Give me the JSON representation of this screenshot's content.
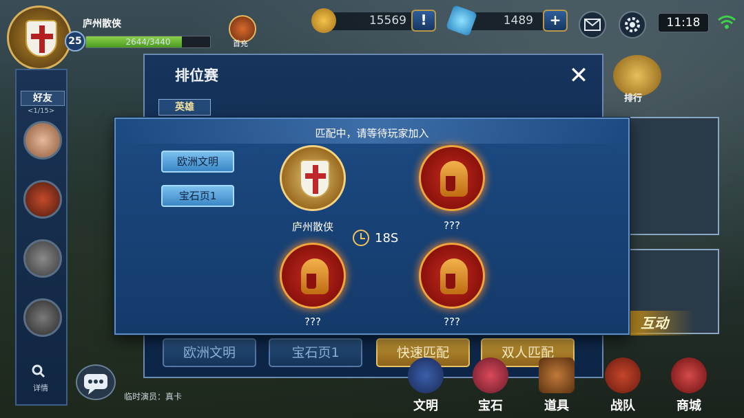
{
  "player": {
    "name": "庐州散侠",
    "level": "25",
    "xp_text": "2644/3440",
    "xp_fraction": 0.77
  },
  "top_bar": {
    "recharge_label": "首充",
    "gold": "15569",
    "gems": "1489",
    "gold_add": "!",
    "gem_add": "+",
    "time": "11:18"
  },
  "sidebar": {
    "friends_label": "好友",
    "friends_count": "<1/15>",
    "detail_label": "详情"
  },
  "rank_panel": {
    "title": "排位赛",
    "close": "✕",
    "hero_tab": "英雄",
    "bottom_buttons": [
      "欧洲文明",
      "宝石页1",
      "快速匹配",
      "双人匹配"
    ]
  },
  "right": {
    "ranking_label": "排行",
    "interact_label": "互动"
  },
  "bottom_nav": [
    "文明",
    "宝石",
    "道具",
    "战队",
    "商城"
  ],
  "chat": {
    "text": "临时演员：真卡"
  },
  "modal": {
    "title": "匹配中，请等待玩家加入",
    "civilization": "欧洲文明",
    "gem_page": "宝石页1",
    "timer": "18S",
    "slots": [
      {
        "label": "庐州散侠"
      },
      {
        "label": "???"
      },
      {
        "label": "???"
      },
      {
        "label": "???"
      }
    ]
  },
  "colors": {
    "modal_bg": "#1c4a82",
    "gold_button": "#c79a37",
    "blue_button": "#29517f",
    "pill": "#7ac0ee"
  }
}
